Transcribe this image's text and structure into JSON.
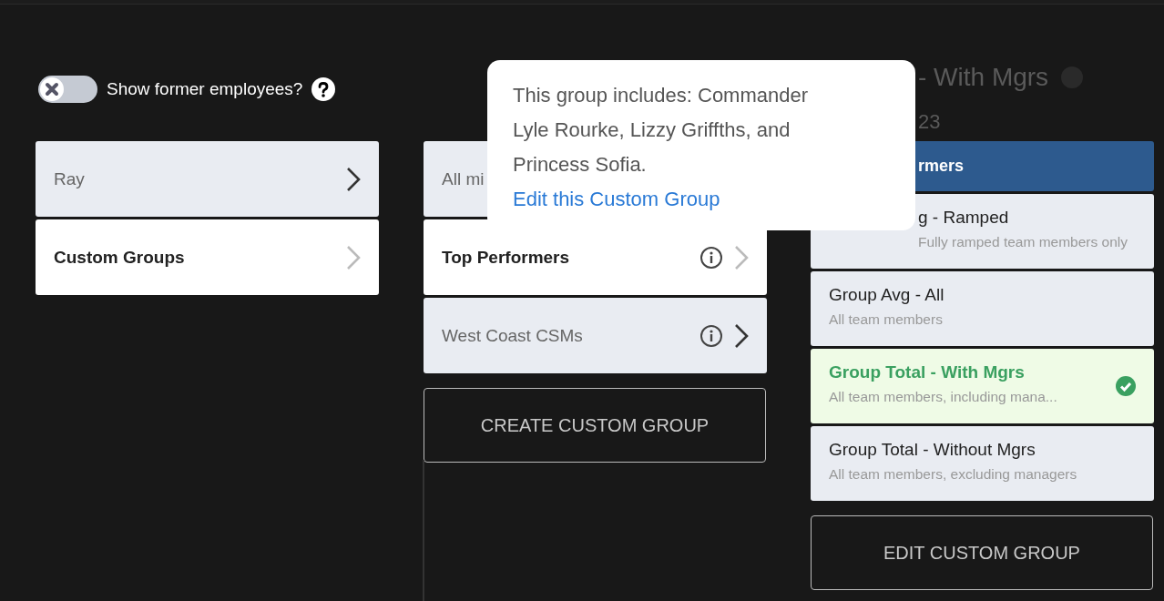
{
  "toggle": {
    "label": "Show former employees?",
    "on": false
  },
  "column_1": {
    "items": [
      {
        "label": "Ray",
        "selected": false
      },
      {
        "label": "Custom Groups",
        "selected": true
      }
    ]
  },
  "column_2": {
    "items": [
      {
        "label": "All mi",
        "selected": false,
        "info": false,
        "covered": true
      },
      {
        "label": "Top Performers",
        "selected": true,
        "info": true
      },
      {
        "label": "West Coast CSMs",
        "selected": false,
        "info": true
      }
    ],
    "button": "CREATE CUSTOM GROUP"
  },
  "tooltip": {
    "text": "This group includes: Commander Lyle Rourke, Lizzy Griffths, and Princess Sofia.",
    "link": "Edit this Custom Group"
  },
  "column_3": {
    "heading": "- With Mgrs",
    "subheading": "23",
    "header": "rmers",
    "items": [
      {
        "title": "g - Ramped",
        "subtitle": "Fully ramped team members only",
        "selected": false,
        "covered": true
      },
      {
        "title": "Group Avg - All",
        "subtitle": "All team members",
        "selected": false
      },
      {
        "title": "Group Total - With Mgrs",
        "subtitle": "All team members, including mana...",
        "selected": true
      },
      {
        "title": "Group Total - Without Mgrs",
        "subtitle": "All team members, excluding managers",
        "selected": false
      }
    ],
    "button": "EDIT CUSTOM GROUP"
  }
}
